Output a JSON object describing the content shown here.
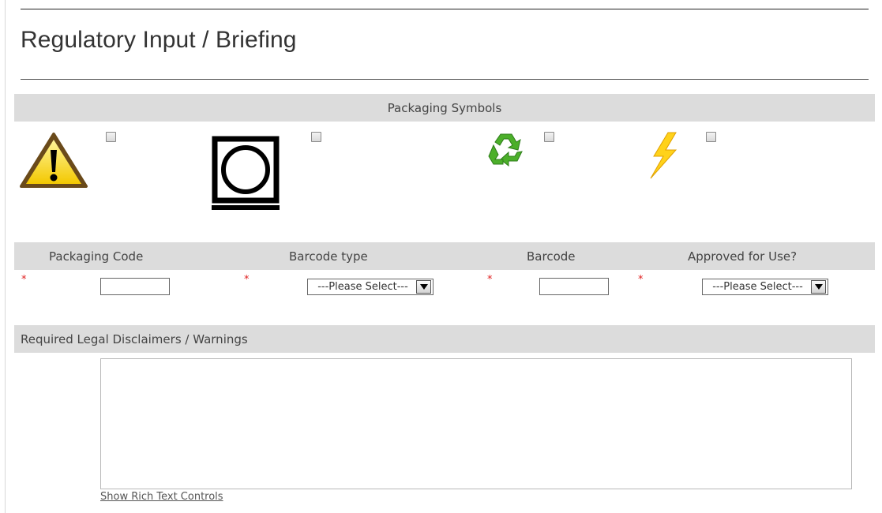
{
  "page": {
    "title": "Regulatory Input / Briefing"
  },
  "symbols_section": {
    "header": "Packaging Symbols",
    "symbols": [
      {
        "icon": "warning-triangle-icon",
        "checked": false
      },
      {
        "icon": "dry-clean-symbol-icon",
        "checked": false
      },
      {
        "icon": "recycle-icon",
        "checked": false
      },
      {
        "icon": "lightning-bolt-icon",
        "checked": false
      }
    ]
  },
  "fields_section": {
    "columns": [
      "Packaging Code",
      "Barcode type",
      "Barcode",
      "Approved for Use?"
    ],
    "required_mark": "*",
    "packaging_code_value": "",
    "barcode_type_value": "---Please Select---",
    "barcode_value": "",
    "approved_value": "---Please Select---"
  },
  "disclaimers_section": {
    "header": "Required Legal Disclaimers / Warnings",
    "text_value": "",
    "rich_text_link": "Show Rich Text Controls"
  },
  "colors": {
    "section_bar": "#dcdcdc",
    "required_star": "#e02020",
    "warning_yellow": "#f5d000",
    "recycle_green": "#4caf2a",
    "bolt_yellow": "#ffd21a"
  }
}
